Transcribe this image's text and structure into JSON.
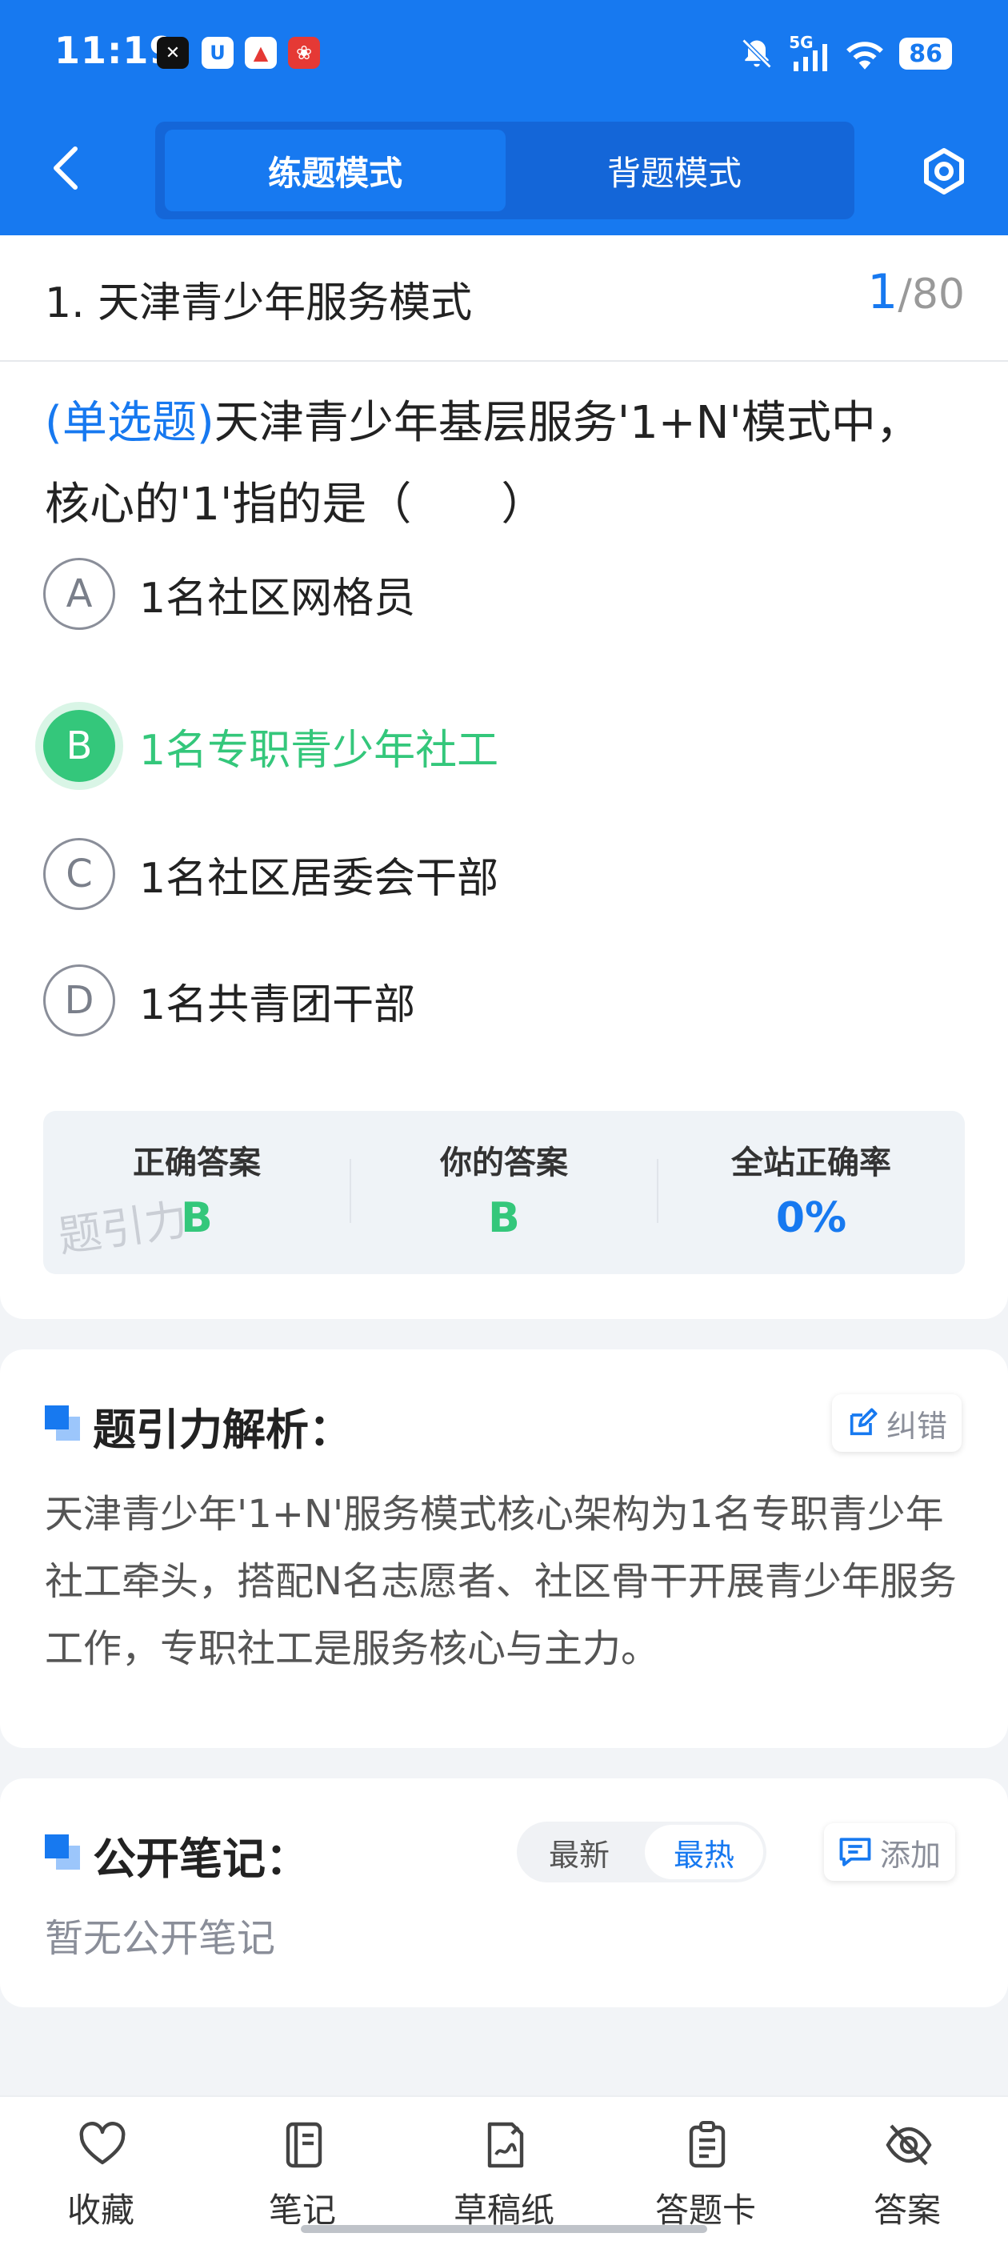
{
  "status_bar": {
    "time": "11:19",
    "signal": "5G",
    "battery": "86"
  },
  "header": {
    "modes": [
      "练题模式",
      "背题模式"
    ],
    "active_mode": "练题模式"
  },
  "question": {
    "title": "1. 天津青少年服务模式",
    "current": "1",
    "total": "/80",
    "type_label": "(单选题)",
    "text": "天津青少年基层服务'1+N'模式中，核心的'1'指的是（　　）",
    "options": [
      {
        "letter": "A",
        "text": "1名社区网格员"
      },
      {
        "letter": "B",
        "text": "1名专职青少年社工",
        "selected": true
      },
      {
        "letter": "C",
        "text": "1名社区居委会干部"
      },
      {
        "letter": "D",
        "text": "1名共青团干部"
      }
    ]
  },
  "answer_summary": {
    "correct_label": "正确答案",
    "correct_value": "B",
    "yours_label": "你的答案",
    "yours_value": "B",
    "rate_label": "全站正确率",
    "rate_value": "0%",
    "watermark": "题引力"
  },
  "analysis": {
    "title": "题引力解析：",
    "report_button": "纠错",
    "text": "天津青少年'1+N'服务模式核心架构为1名专职青少年社工牵头，搭配N名志愿者、社区骨干开展青少年服务工作，专职社工是服务核心与主力。"
  },
  "notes": {
    "title": "公开笔记：",
    "sort_options": [
      "最新",
      "最热"
    ],
    "active_sort": "最热",
    "add_button": "添加",
    "empty_text": "暂无公开笔记"
  },
  "bottom_nav": [
    {
      "label": "收藏",
      "icon": "heart-icon"
    },
    {
      "label": "笔记",
      "icon": "notebook-icon"
    },
    {
      "label": "草稿纸",
      "icon": "draft-icon"
    },
    {
      "label": "答题卡",
      "icon": "answer-card-icon"
    },
    {
      "label": "答案",
      "icon": "eye-off-icon"
    }
  ],
  "colors": {
    "primary": "#1779f0",
    "correct": "#34c77b",
    "muted": "#8a8e99"
  }
}
